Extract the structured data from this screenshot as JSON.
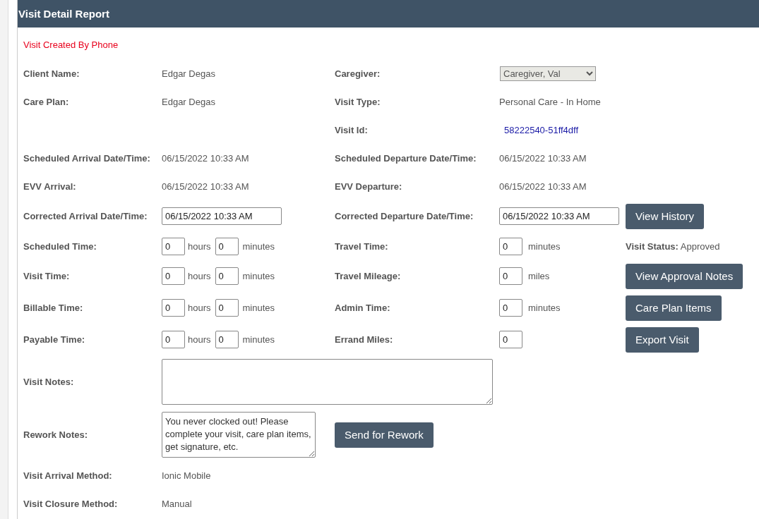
{
  "title": "Visit Detail Report",
  "alert": "Visit Created By Phone",
  "rows": [
    {
      "cells": [
        {
          "kind": "label",
          "text": "Client Name:"
        },
        {
          "kind": "text",
          "text": "Edgar Degas"
        },
        {
          "kind": "label",
          "text": "Caregiver:"
        },
        {
          "kind": "select",
          "value": "Caregiver, Val"
        },
        null
      ]
    },
    {
      "cells": [
        {
          "kind": "label",
          "text": "Care Plan:"
        },
        {
          "kind": "text",
          "text": "Edgar Degas"
        },
        {
          "kind": "label",
          "text": "Visit Type:"
        },
        {
          "kind": "text",
          "text": "Personal Care - In Home"
        },
        null
      ]
    },
    {
      "cells": [
        null,
        null,
        {
          "kind": "label",
          "text": "Visit Id:"
        },
        {
          "kind": "code",
          "text": "58222540-51ff4dff"
        },
        null
      ]
    },
    {
      "cells": [
        {
          "kind": "label",
          "text": "Scheduled Arrival Date/Time:"
        },
        {
          "kind": "text",
          "text": "06/15/2022 10:33 AM"
        },
        {
          "kind": "label",
          "text": "Scheduled Departure Date/Time:"
        },
        {
          "kind": "text",
          "text": "06/15/2022 10:33 AM"
        },
        null
      ]
    },
    {
      "cells": [
        {
          "kind": "label",
          "text": "EVV Arrival:"
        },
        {
          "kind": "text",
          "text": "06/15/2022 10:33 AM"
        },
        {
          "kind": "label",
          "text": "EVV Departure:"
        },
        {
          "kind": "text",
          "text": "06/15/2022 10:33 AM"
        },
        null
      ]
    },
    {
      "cells": [
        {
          "kind": "label",
          "text": "Corrected Arrival Date/Time:"
        },
        {
          "kind": "input",
          "value": "06/15/2022 10:33 AM"
        },
        {
          "kind": "label",
          "text": "Corrected Departure Date/Time:"
        },
        {
          "kind": "input",
          "value": "06/15/2022 10:33 AM"
        },
        {
          "kind": "button",
          "label": "View History"
        }
      ]
    },
    {
      "cells": [
        {
          "kind": "label",
          "text": "Scheduled Time:"
        },
        {
          "kind": "duration",
          "hours": "0",
          "hours_unit": "hours",
          "minutes": "0",
          "minutes_unit": "minutes"
        },
        {
          "kind": "label",
          "text": "Travel Time:"
        },
        {
          "kind": "number",
          "value": "0",
          "unit": "minutes"
        },
        {
          "kind": "status",
          "text": "**Visit Status:** Approved"
        }
      ]
    },
    {
      "cells": [
        {
          "kind": "label",
          "text": "Visit Time:"
        },
        {
          "kind": "duration",
          "hours": "0",
          "hours_unit": "hours",
          "minutes": "0",
          "minutes_unit": "minutes"
        },
        {
          "kind": "label",
          "text": "Travel Mileage:"
        },
        {
          "kind": "number",
          "value": "0",
          "unit": "miles"
        },
        {
          "kind": "button",
          "label": "View Approval Notes"
        }
      ]
    },
    {
      "cells": [
        {
          "kind": "label",
          "text": "Billable Time:"
        },
        {
          "kind": "duration",
          "hours": "0",
          "hours_unit": "hours",
          "minutes": "0",
          "minutes_unit": "minutes"
        },
        {
          "kind": "label",
          "text": "Admin Time:"
        },
        {
          "kind": "number",
          "value": "0",
          "unit": "minutes"
        },
        {
          "kind": "button",
          "label": "Care Plan Items"
        }
      ]
    },
    {
      "cells": [
        {
          "kind": "label",
          "text": "Payable Time:"
        },
        {
          "kind": "duration",
          "hours": "0",
          "hours_unit": "hours",
          "minutes": "0",
          "minutes_unit": "minutes"
        },
        {
          "kind": "label",
          "text": "Errand Miles:"
        },
        {
          "kind": "number",
          "value": "0"
        },
        {
          "kind": "button",
          "label": "Export Visit"
        }
      ]
    },
    {
      "cells": [
        {
          "kind": "label",
          "text": "Visit Notes:"
        },
        {
          "kind": "wide-textarea"
        },
        null,
        null,
        null
      ]
    },
    {
      "cells": [
        {
          "kind": "label",
          "text": "Rework Notes:"
        },
        {
          "kind": "textarea",
          "value": "You never clocked out! Please complete your visit, care plan items, get signature, etc."
        },
        {
          "kind": "button",
          "label": "Send for Rework"
        },
        null,
        null
      ]
    },
    {
      "cells": [
        {
          "kind": "label",
          "text": "Visit Arrival Method:"
        },
        {
          "kind": "text",
          "text": "Ionic Mobile"
        },
        null,
        null,
        null
      ]
    },
    {
      "cells": [
        {
          "kind": "label",
          "text": "Visit Closure Method:"
        },
        {
          "kind": "text",
          "text": "Manual"
        },
        null,
        null,
        null
      ]
    }
  ]
}
